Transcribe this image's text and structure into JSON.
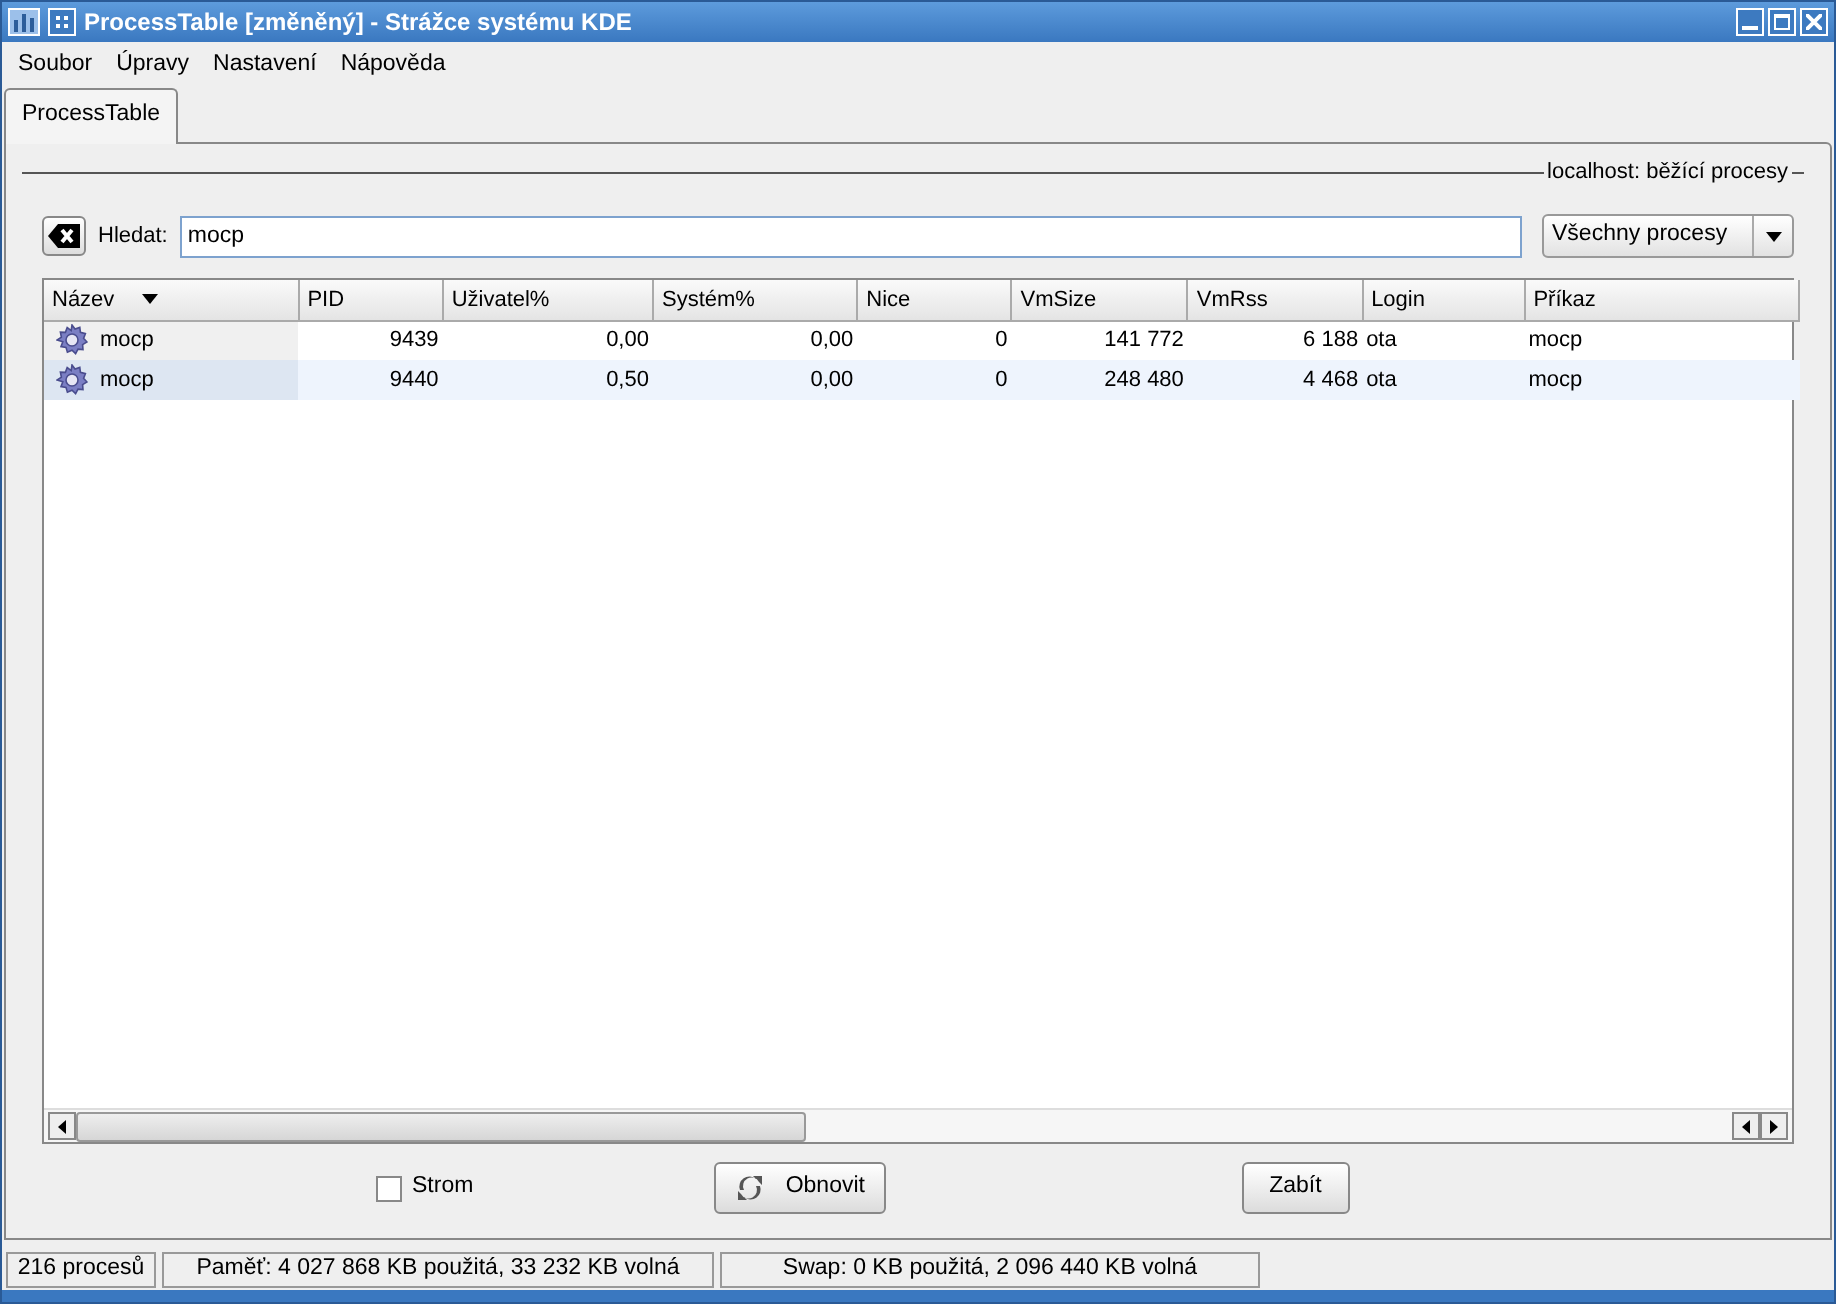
{
  "window": {
    "title": "ProcessTable [změněný] - Strážce systému KDE"
  },
  "menu": [
    "Soubor",
    "Úpravy",
    "Nastavení",
    "Nápověda"
  ],
  "tabs": [
    {
      "label": "ProcessTable",
      "selected": true
    }
  ],
  "group_title": "localhost: běžící procesy",
  "search": {
    "label": "Hledat:",
    "value": "mocp"
  },
  "filter": {
    "value": "Všechny procesy"
  },
  "table": {
    "columns": [
      {
        "label": "Název",
        "sorted": true
      },
      {
        "label": "PID",
        "sorted": false
      },
      {
        "label": "Uživatel%",
        "sorted": false
      },
      {
        "label": "Systém%",
        "sorted": false
      },
      {
        "label": "Nice",
        "sorted": false
      },
      {
        "label": "VmSize",
        "sorted": false
      },
      {
        "label": "VmRss",
        "sorted": false
      },
      {
        "label": "Login",
        "sorted": false
      },
      {
        "label": "Příkaz",
        "sorted": false
      }
    ],
    "rows": [
      [
        "mocp",
        "9439",
        "0,00",
        "0,00",
        "0",
        "141 772",
        "6 188",
        "ota",
        "mocp"
      ],
      [
        "mocp",
        "9440",
        "0,50",
        "0,00",
        "0",
        "248 480",
        "4 468",
        "ota",
        "mocp"
      ]
    ]
  },
  "tree_checkbox": {
    "label": "Strom",
    "checked": false
  },
  "buttons": [
    {
      "label": "Obnovit",
      "kind": "refresh"
    },
    {
      "label": "Zabít",
      "kind": "plain"
    }
  ],
  "status_bar": [
    "216 procesů",
    "Paměť: 4 027 868 KB použitá, 33 232 KB volná",
    "Swap: 0 KB použitá, 2 096 440 KB volná"
  ]
}
